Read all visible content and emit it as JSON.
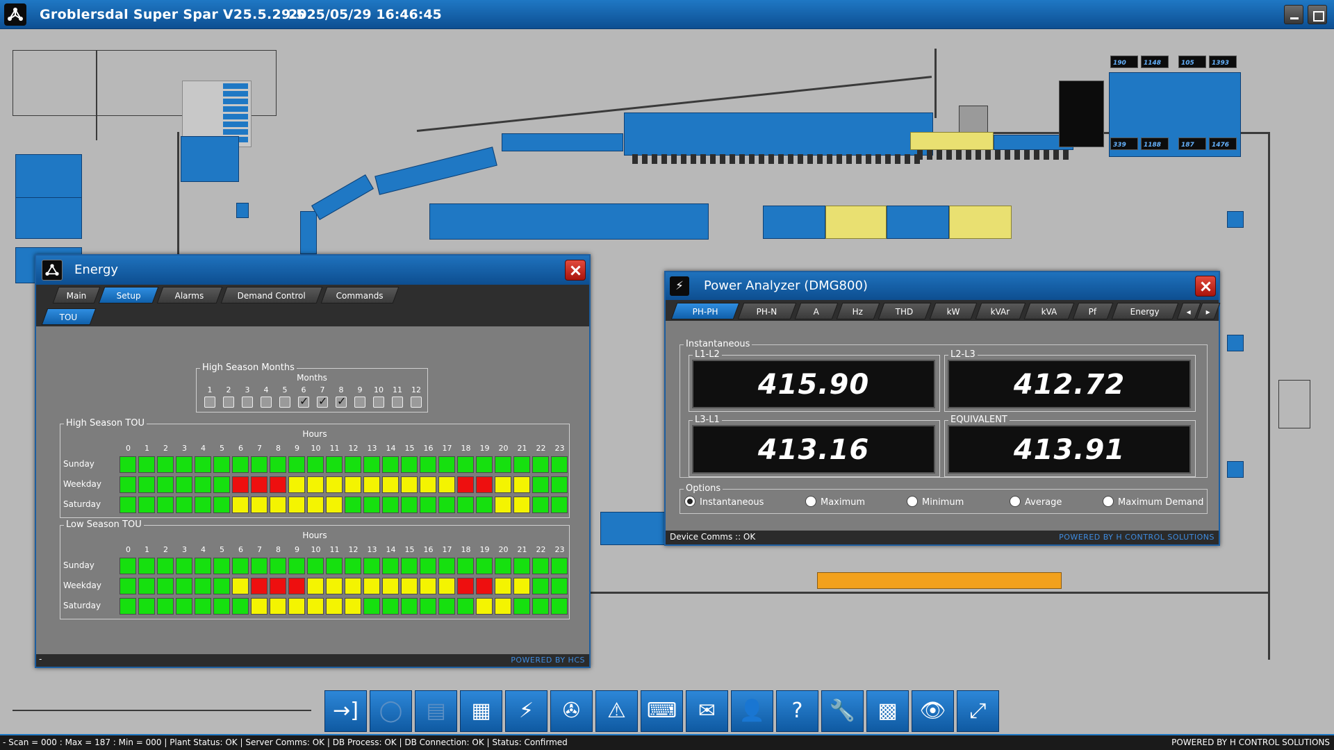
{
  "titlebar": {
    "title": "Groblersdal Super Spar V25.5.29.5",
    "datetime": "2025/05/29 16:46:45"
  },
  "energy": {
    "title": "Energy",
    "tabs": [
      "Main",
      "Setup",
      "Alarms",
      "Demand Control",
      "Commands"
    ],
    "active_tab": "Setup",
    "subtab": "TOU",
    "high_season_months": {
      "title": "High Season Months",
      "subtitle": "Months",
      "months": [
        "1",
        "2",
        "3",
        "4",
        "5",
        "6",
        "7",
        "8",
        "9",
        "10",
        "11",
        "12"
      ],
      "checked": [
        false,
        false,
        false,
        false,
        false,
        true,
        true,
        true,
        false,
        false,
        false,
        false
      ]
    },
    "hours_title": "Hours",
    "hours": [
      "0",
      "1",
      "2",
      "3",
      "4",
      "5",
      "6",
      "7",
      "8",
      "9",
      "10",
      "11",
      "12",
      "13",
      "14",
      "15",
      "16",
      "17",
      "18",
      "19",
      "20",
      "21",
      "22",
      "23"
    ],
    "days": [
      "Sunday",
      "Weekday",
      "Saturday"
    ],
    "high_season": {
      "title": "High Season TOU",
      "rows": [
        "gggggggggggggggggggggggg",
        "ggggggrrryyyyyyyyyrryygg",
        "ggggggyyyyyyggggggggyygg"
      ]
    },
    "low_season": {
      "title": "Low Season TOU",
      "rows": [
        "gggggggggggggggggggggggg",
        "ggggggyrrryyyyyyyyrryygg",
        "gggggggyyyyyyggggggyyggg"
      ]
    },
    "footer_left": "-",
    "powered": "POWERED BY HCS"
  },
  "power_analyzer": {
    "title": "Power Analyzer (DMG800)",
    "tabs": [
      "PH-PH",
      "PH-N",
      "A",
      "Hz",
      "THD",
      "kW",
      "kVAr",
      "kVA",
      "Pf",
      "Energy"
    ],
    "active_tab": "PH-PH",
    "group_title": "Instantaneous",
    "readings": [
      {
        "label": "L1-L2",
        "value": "415.90"
      },
      {
        "label": "L2-L3",
        "value": "412.72"
      },
      {
        "label": "L3-L1",
        "value": "413.16"
      },
      {
        "label": "EQUIVALENT",
        "value": "413.91"
      }
    ],
    "options_title": "Options",
    "options": [
      "Instantaneous",
      "Maximum",
      "Minimum",
      "Average",
      "Maximum Demand"
    ],
    "selected_option": "Instantaneous",
    "comms": "Device Comms :: OK",
    "powered": "POWERED BY H CONTROL SOLUTIONS"
  },
  "racks": [
    {
      "value": "190"
    },
    {
      "value": "1148"
    },
    {
      "value": "105"
    },
    {
      "value": "1393"
    },
    {
      "value": "339"
    },
    {
      "value": "1188"
    },
    {
      "value": "187"
    },
    {
      "value": "1476"
    }
  ],
  "toolbar": [
    {
      "name": "login-button",
      "icon": "→]"
    },
    {
      "name": "refresh-button",
      "icon": "◯"
    },
    {
      "name": "save-button",
      "icon": "▤"
    },
    {
      "name": "schedule-button",
      "icon": "▦"
    },
    {
      "name": "energy-button",
      "icon": "⚡"
    },
    {
      "name": "hvac-button",
      "icon": "✇"
    },
    {
      "name": "alarm-button",
      "icon": "⚠"
    },
    {
      "name": "keyboard-button",
      "icon": "⌨"
    },
    {
      "name": "mail-button",
      "icon": "✉"
    },
    {
      "name": "user-settings-button",
      "icon": "👤"
    },
    {
      "name": "help-button",
      "icon": "?"
    },
    {
      "name": "tools-button",
      "icon": "🔧"
    },
    {
      "name": "qr-button",
      "icon": "▩"
    },
    {
      "name": "view-button",
      "icon": "👁"
    },
    {
      "name": "expand-button",
      "icon": "⤢"
    }
  ],
  "statusbar": {
    "left": "- Scan = 000 : Max = 187 : Min = 000  |  Plant Status: OK  |  Server Comms: OK  |  DB Process: OK  |  DB Connection:  OK  |  Status: Confirmed",
    "right": "POWERED BY H CONTROL SOLUTIONS"
  },
  "colors": {
    "accent": "#1f78c4",
    "green": "#16e00f",
    "yellow": "#f4f401",
    "red": "#ee0f0f"
  }
}
